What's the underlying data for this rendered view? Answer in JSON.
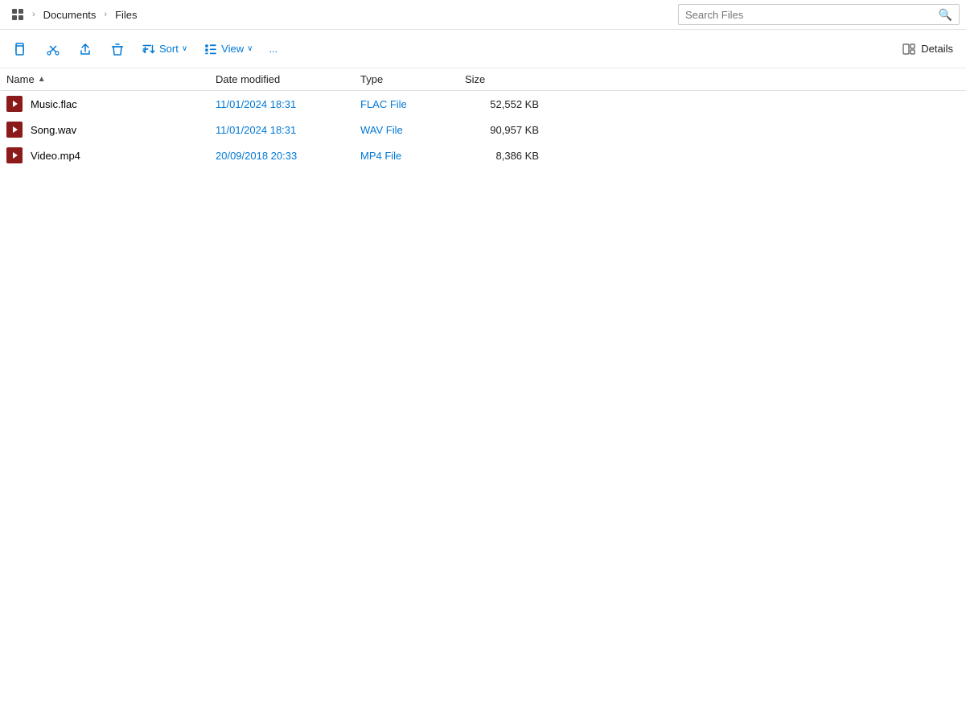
{
  "titlebar": {
    "breadcrumbs": [
      {
        "label": "Documents",
        "id": "documents"
      },
      {
        "label": "Files",
        "id": "files"
      }
    ],
    "search_placeholder": "Search Files"
  },
  "toolbar": {
    "new_label": "",
    "cut_label": "",
    "share_label": "",
    "delete_label": "",
    "sort_label": "Sort",
    "view_label": "View",
    "more_label": "...",
    "details_label": "Details"
  },
  "columns": {
    "name": "Name",
    "date_modified": "Date modified",
    "type": "Type",
    "size": "Size"
  },
  "files": [
    {
      "name": "Music.flac",
      "date_modified": "11/01/2024 18:31",
      "type": "FLAC File",
      "size": "52,552 KB"
    },
    {
      "name": "Song.wav",
      "date_modified": "11/01/2024 18:31",
      "type": "WAV File",
      "size": "90,957 KB"
    },
    {
      "name": "Video.mp4",
      "date_modified": "20/09/2018 20:33",
      "type": "MP4 File",
      "size": "8,386 KB"
    }
  ]
}
